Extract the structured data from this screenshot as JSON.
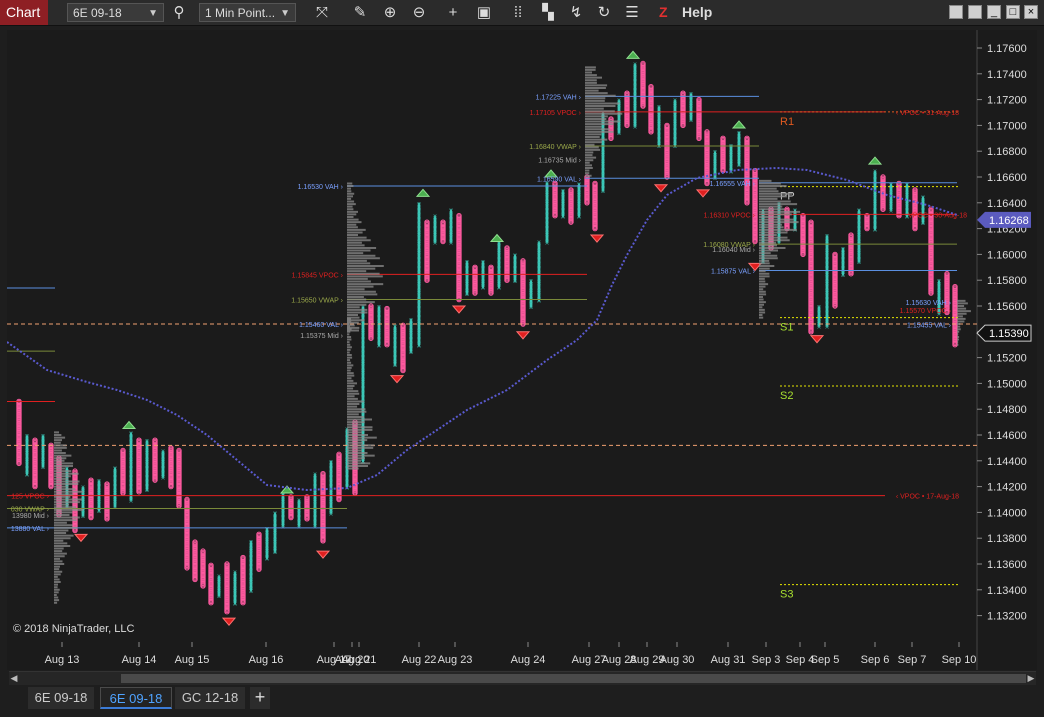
{
  "toolbar": {
    "chart_label": "Chart",
    "instrument": "6E 09-18",
    "interval": "1 Min Point...",
    "help_z": "Z",
    "help_label": "Help",
    "icons": [
      "search-icon",
      "pointer-icon",
      "draw-icon",
      "zoom-in-icon",
      "zoom-out-icon",
      "crosshair-icon",
      "data-box-icon",
      "bars-icon",
      "strategies-icon",
      "indicators-icon",
      "refresh-icon",
      "properties-icon"
    ]
  },
  "window": {
    "minimize": "_",
    "maximize": "□",
    "close": "×"
  },
  "chart": {
    "copyright": "© 2018 NinjaTrader, LLC",
    "price_axis": [
      "1.17600",
      "1.17400",
      "1.17200",
      "1.17000",
      "1.16800",
      "1.16600",
      "1.16400",
      "1.16200",
      "1.16000",
      "1.15800",
      "1.15600",
      "1.15400",
      "1.15200",
      "1.15000",
      "1.14800",
      "1.14600",
      "1.14400",
      "1.14200",
      "1.14000",
      "1.13800",
      "1.13600",
      "1.13400",
      "1.13200"
    ],
    "price_marker_blue": "1.16268",
    "price_marker_last": "1.15390",
    "date_axis": [
      "Aug 13",
      "Aug 14",
      "Aug 15",
      "Aug 16",
      "Aug 17",
      "Aug 20",
      "Aug 21",
      "Aug 22",
      "Aug 23",
      "Aug 24",
      "Aug 27",
      "Aug 28",
      "Aug 29",
      "Aug 30",
      "Aug 31",
      "Sep 3",
      "Sep 4",
      "Sep 5",
      "Sep 6",
      "Sep 7",
      "Sep 10"
    ],
    "pivots": {
      "r1": "R1",
      "pp": "PP",
      "s1": "S1",
      "s2": "S2",
      "s3": "S3"
    },
    "labels": {
      "vpoc_31aug": "‹ VPOC • 31-Aug-18",
      "vpoc_17aug": "‹ VPOC • 17-Aug-18",
      "vpoc_right": "VPOC • 30-Aug-18",
      "vah_1": "1.17225 VAH ›",
      "vpoc_1": "1.17105 VPOC ›",
      "vwap_1": "1.16840 VWAP ›",
      "mid_1": "1.16735 Mid ›",
      "val_1": "1.16590 VAL ›",
      "vah_2": "1.16530 VAH ›",
      "vpoc_2": "1.15845 VPOC ›",
      "vwap_2": "1.15650 VWAP ›",
      "val_2": "1.15460 VAL ›",
      "mid_2": "1.15375 Mid ›",
      "vah_3": "1.16555 VAH ›",
      "vpoc_3": "1.16310 VPOC ›",
      "vwap_3": "1.16080 VWAP ›",
      "mid_3": "1.16040 Mid ›",
      "val_3": "1.15875 VAL ›",
      "vah_4": "1.15630 VAH ›",
      "vpoc_4": "1.15570 VPOC ›",
      "val_4": "1.15455 VAL ›",
      "vpoc_left": "125 VPOC ›",
      "vwap_left": "030 VWAP ›",
      "mid_left": "13980 Mid ›",
      "val_left": "13880 VAL ›"
    }
  },
  "tabs": [
    {
      "label": "6E 09-18",
      "active": false
    },
    {
      "label": "6E 09-18",
      "active": true
    },
    {
      "label": "GC 12-18",
      "active": false
    }
  ],
  "tab_add": "+",
  "colors": {
    "x_box": "#3fd3c2",
    "o_box": "#ff5aa0",
    "vpoc": "#e02020",
    "vah": "#5b8fe0",
    "vwap": "#7a8a3a",
    "pivot_line": "#e6e600",
    "vwap_curve": "#5a5ad0",
    "session_dash": "#f0a070"
  }
}
